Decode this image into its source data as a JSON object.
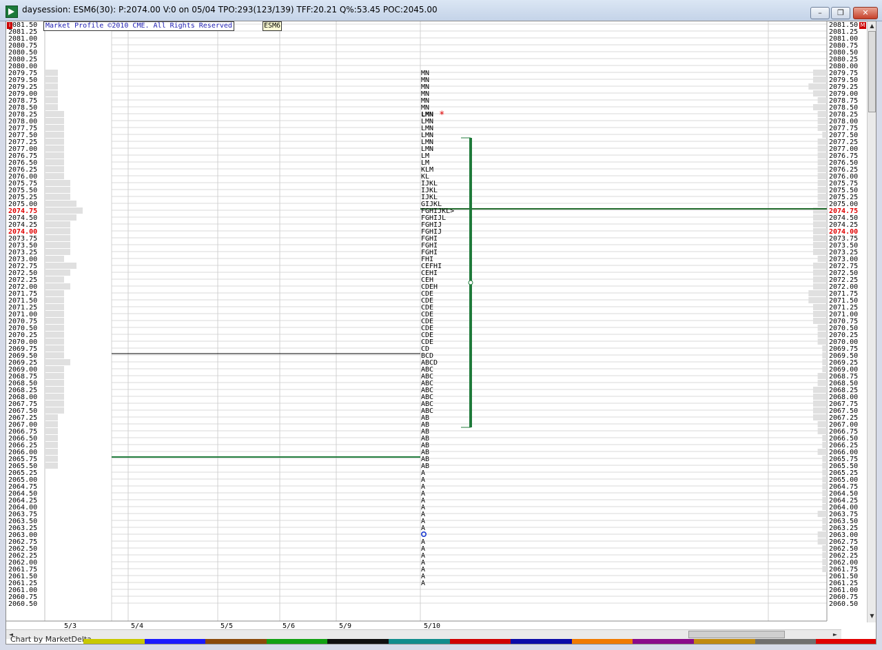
{
  "window": {
    "title": "daysession: ESM6(30): P:2074.00 V:0 on 05/04 TPO:293(123/139) TFF:20.21 Q%:53.45 POC:2045.00",
    "minimize_label": "–",
    "maximize_label": "❐",
    "close_label": "✕"
  },
  "header": {
    "copyright": "Market Profile ©2010 CME. All Rights Reserved",
    "symbol": "ESM6",
    "left_marker": "i",
    "right_marker": "M"
  },
  "credit": "Chart by MarketDelta",
  "scroll": {
    "up": "▲",
    "down": "▼",
    "left": "◄",
    "right": "►"
  },
  "colors": {
    "grid": "#d8d8d8",
    "value_area_line": "#1f7a3a",
    "poc_line": "#1f6a2a",
    "price_red": "#e00000",
    "volume_bar": "#e0e0e0",
    "tpo_text": "#000000",
    "close_marker": "#e00000",
    "open_marker": "#1a3ad0"
  },
  "color_strip": [
    "#c8c800",
    "#1a1aff",
    "#8b4a0a",
    "#12a012",
    "#101010",
    "#108c8c",
    "#d00000",
    "#0a0aa8",
    "#f07a00",
    "#8a0a8a",
    "#c08a10",
    "#707070",
    "#e00000"
  ],
  "chart_data": {
    "type": "table",
    "price_max": 2081.5,
    "price_min": 2060.5,
    "tick_size": 0.25,
    "highlighted_prices": [
      "2074.75",
      "2074.00"
    ],
    "sessions": [
      "5/3",
      "5/4",
      "5/5",
      "5/6",
      "5/9",
      "5/10"
    ],
    "reference_lines": [
      {
        "name": "value-area-high-ref",
        "price": 2069.5
      },
      {
        "name": "value-area-low-ref",
        "price": 2065.75
      },
      {
        "name": "poc-line",
        "price": 2074.75
      }
    ],
    "value_area": {
      "high": 2077.25,
      "low": 2067.0
    },
    "poc_label": "FGHIJKL>",
    "close_marker": "*",
    "open_marker": "o",
    "tpo_rows": [
      {
        "price": 2079.75,
        "letters": "MN"
      },
      {
        "price": 2079.5,
        "letters": "MN"
      },
      {
        "price": 2079.25,
        "letters": "MN"
      },
      {
        "price": 2079.0,
        "letters": "MN"
      },
      {
        "price": 2078.75,
        "letters": "MN"
      },
      {
        "price": 2078.5,
        "letters": "MN"
      },
      {
        "price": 2078.25,
        "letters": "LMN"
      },
      {
        "price": 2078.0,
        "letters": "LMN"
      },
      {
        "price": 2077.75,
        "letters": "LMN"
      },
      {
        "price": 2077.5,
        "letters": "LMN"
      },
      {
        "price": 2077.25,
        "letters": "LMN"
      },
      {
        "price": 2077.0,
        "letters": "LMN"
      },
      {
        "price": 2076.75,
        "letters": "LM"
      },
      {
        "price": 2076.5,
        "letters": "LM"
      },
      {
        "price": 2076.25,
        "letters": "KLM"
      },
      {
        "price": 2076.0,
        "letters": "KL"
      },
      {
        "price": 2075.75,
        "letters": "IJKL"
      },
      {
        "price": 2075.5,
        "letters": "IJKL"
      },
      {
        "price": 2075.25,
        "letters": "IJKL"
      },
      {
        "price": 2075.0,
        "letters": "GIJKL"
      },
      {
        "price": 2074.75,
        "letters": "FGHIJKL>"
      },
      {
        "price": 2074.5,
        "letters": "FGHIJL"
      },
      {
        "price": 2074.25,
        "letters": "FGHIJ"
      },
      {
        "price": 2074.0,
        "letters": "FGHIJ"
      },
      {
        "price": 2073.75,
        "letters": "FGHI"
      },
      {
        "price": 2073.5,
        "letters": "FGHI"
      },
      {
        "price": 2073.25,
        "letters": "FGHI"
      },
      {
        "price": 2073.0,
        "letters": "FHI"
      },
      {
        "price": 2072.75,
        "letters": "CEFHI"
      },
      {
        "price": 2072.5,
        "letters": "CEHI"
      },
      {
        "price": 2072.25,
        "letters": "CEH"
      },
      {
        "price": 2072.0,
        "letters": "CDEH"
      },
      {
        "price": 2071.75,
        "letters": "CDE"
      },
      {
        "price": 2071.5,
        "letters": "CDE"
      },
      {
        "price": 2071.25,
        "letters": "CDE"
      },
      {
        "price": 2071.0,
        "letters": "CDE"
      },
      {
        "price": 2070.75,
        "letters": "CDE"
      },
      {
        "price": 2070.5,
        "letters": "CDE"
      },
      {
        "price": 2070.25,
        "letters": "CDE"
      },
      {
        "price": 2070.0,
        "letters": "CDE"
      },
      {
        "price": 2069.75,
        "letters": "CD"
      },
      {
        "price": 2069.5,
        "letters": "BCD"
      },
      {
        "price": 2069.25,
        "letters": "ABCD"
      },
      {
        "price": 2069.0,
        "letters": "ABC"
      },
      {
        "price": 2068.75,
        "letters": "ABC"
      },
      {
        "price": 2068.5,
        "letters": "ABC"
      },
      {
        "price": 2068.25,
        "letters": "ABC"
      },
      {
        "price": 2068.0,
        "letters": "ABC"
      },
      {
        "price": 2067.75,
        "letters": "ABC"
      },
      {
        "price": 2067.5,
        "letters": "ABC"
      },
      {
        "price": 2067.25,
        "letters": "AB"
      },
      {
        "price": 2067.0,
        "letters": "AB"
      },
      {
        "price": 2066.75,
        "letters": "AB"
      },
      {
        "price": 2066.5,
        "letters": "AB"
      },
      {
        "price": 2066.25,
        "letters": "AB"
      },
      {
        "price": 2066.0,
        "letters": "AB"
      },
      {
        "price": 2065.75,
        "letters": "AB"
      },
      {
        "price": 2065.5,
        "letters": "AB"
      },
      {
        "price": 2065.25,
        "letters": "A"
      },
      {
        "price": 2065.0,
        "letters": "A"
      },
      {
        "price": 2064.75,
        "letters": "A"
      },
      {
        "price": 2064.5,
        "letters": "A"
      },
      {
        "price": 2064.25,
        "letters": "A"
      },
      {
        "price": 2064.0,
        "letters": "A"
      },
      {
        "price": 2063.75,
        "letters": "A"
      },
      {
        "price": 2063.5,
        "letters": "A"
      },
      {
        "price": 2063.25,
        "letters": "A"
      },
      {
        "price": 2063.0,
        "letters": "o"
      },
      {
        "price": 2062.75,
        "letters": "A"
      },
      {
        "price": 2062.5,
        "letters": "A"
      },
      {
        "price": 2062.25,
        "letters": "A"
      },
      {
        "price": 2062.0,
        "letters": "A"
      },
      {
        "price": 2061.75,
        "letters": "A"
      },
      {
        "price": 2061.5,
        "letters": "A"
      },
      {
        "price": 2061.25,
        "letters": "A"
      }
    ],
    "left_volume_profile": [
      {
        "price": 2079.75,
        "volume": 2
      },
      {
        "price": 2079.5,
        "volume": 2
      },
      {
        "price": 2079.25,
        "volume": 2
      },
      {
        "price": 2079.0,
        "volume": 2
      },
      {
        "price": 2078.75,
        "volume": 2
      },
      {
        "price": 2078.5,
        "volume": 2
      },
      {
        "price": 2078.25,
        "volume": 3
      },
      {
        "price": 2078.0,
        "volume": 3
      },
      {
        "price": 2077.75,
        "volume": 3
      },
      {
        "price": 2077.5,
        "volume": 3
      },
      {
        "price": 2077.25,
        "volume": 3
      },
      {
        "price": 2077.0,
        "volume": 3
      },
      {
        "price": 2076.75,
        "volume": 3
      },
      {
        "price": 2076.5,
        "volume": 3
      },
      {
        "price": 2076.25,
        "volume": 3
      },
      {
        "price": 2076.0,
        "volume": 3
      },
      {
        "price": 2075.75,
        "volume": 4
      },
      {
        "price": 2075.5,
        "volume": 4
      },
      {
        "price": 2075.25,
        "volume": 4
      },
      {
        "price": 2075.0,
        "volume": 5
      },
      {
        "price": 2074.75,
        "volume": 6
      },
      {
        "price": 2074.5,
        "volume": 5
      },
      {
        "price": 2074.25,
        "volume": 4
      },
      {
        "price": 2074.0,
        "volume": 4
      },
      {
        "price": 2073.75,
        "volume": 4
      },
      {
        "price": 2073.5,
        "volume": 4
      },
      {
        "price": 2073.25,
        "volume": 4
      },
      {
        "price": 2073.0,
        "volume": 3
      },
      {
        "price": 2072.75,
        "volume": 5
      },
      {
        "price": 2072.5,
        "volume": 4
      },
      {
        "price": 2072.25,
        "volume": 3
      },
      {
        "price": 2072.0,
        "volume": 4
      },
      {
        "price": 2071.75,
        "volume": 3
      },
      {
        "price": 2071.5,
        "volume": 3
      },
      {
        "price": 2071.25,
        "volume": 3
      },
      {
        "price": 2071.0,
        "volume": 3
      },
      {
        "price": 2070.75,
        "volume": 3
      },
      {
        "price": 2070.5,
        "volume": 3
      },
      {
        "price": 2070.25,
        "volume": 3
      },
      {
        "price": 2070.0,
        "volume": 3
      },
      {
        "price": 2069.75,
        "volume": 3
      },
      {
        "price": 2069.5,
        "volume": 3
      },
      {
        "price": 2069.25,
        "volume": 4
      },
      {
        "price": 2069.0,
        "volume": 3
      },
      {
        "price": 2068.75,
        "volume": 3
      },
      {
        "price": 2068.5,
        "volume": 3
      },
      {
        "price": 2068.25,
        "volume": 3
      },
      {
        "price": 2068.0,
        "volume": 3
      },
      {
        "price": 2067.75,
        "volume": 3
      },
      {
        "price": 2067.5,
        "volume": 3
      },
      {
        "price": 2067.25,
        "volume": 2
      },
      {
        "price": 2067.0,
        "volume": 2
      },
      {
        "price": 2066.75,
        "volume": 2
      },
      {
        "price": 2066.5,
        "volume": 2
      },
      {
        "price": 2066.25,
        "volume": 2
      },
      {
        "price": 2066.0,
        "volume": 2
      },
      {
        "price": 2065.75,
        "volume": 2
      },
      {
        "price": 2065.5,
        "volume": 2
      }
    ],
    "right_volume_profile": [
      {
        "price": 2079.75,
        "volume": 3
      },
      {
        "price": 2079.5,
        "volume": 3
      },
      {
        "price": 2079.25,
        "volume": 4
      },
      {
        "price": 2079.0,
        "volume": 3
      },
      {
        "price": 2078.75,
        "volume": 2
      },
      {
        "price": 2078.5,
        "volume": 3
      },
      {
        "price": 2078.25,
        "volume": 2
      },
      {
        "price": 2078.0,
        "volume": 2
      },
      {
        "price": 2077.75,
        "volume": 2
      },
      {
        "price": 2077.5,
        "volume": 1
      },
      {
        "price": 2077.25,
        "volume": 2
      },
      {
        "price": 2077.0,
        "volume": 2
      },
      {
        "price": 2076.75,
        "volume": 2
      },
      {
        "price": 2076.5,
        "volume": 2
      },
      {
        "price": 2076.25,
        "volume": 2
      },
      {
        "price": 2076.0,
        "volume": 2
      },
      {
        "price": 2075.75,
        "volume": 2
      },
      {
        "price": 2075.5,
        "volume": 2
      },
      {
        "price": 2075.25,
        "volume": 2
      },
      {
        "price": 2075.0,
        "volume": 2
      },
      {
        "price": 2074.75,
        "volume": 3
      },
      {
        "price": 2074.5,
        "volume": 3
      },
      {
        "price": 2074.25,
        "volume": 3
      },
      {
        "price": 2074.0,
        "volume": 3
      },
      {
        "price": 2073.75,
        "volume": 3
      },
      {
        "price": 2073.5,
        "volume": 3
      },
      {
        "price": 2073.25,
        "volume": 3
      },
      {
        "price": 2073.0,
        "volume": 2
      },
      {
        "price": 2072.75,
        "volume": 3
      },
      {
        "price": 2072.5,
        "volume": 3
      },
      {
        "price": 2072.25,
        "volume": 3
      },
      {
        "price": 2072.0,
        "volume": 3
      },
      {
        "price": 2071.75,
        "volume": 4
      },
      {
        "price": 2071.5,
        "volume": 4
      },
      {
        "price": 2071.25,
        "volume": 3
      },
      {
        "price": 2071.0,
        "volume": 3
      },
      {
        "price": 2070.75,
        "volume": 3
      },
      {
        "price": 2070.5,
        "volume": 2
      },
      {
        "price": 2070.25,
        "volume": 2
      },
      {
        "price": 2070.0,
        "volume": 2
      },
      {
        "price": 2069.75,
        "volume": 1
      },
      {
        "price": 2069.5,
        "volume": 1
      },
      {
        "price": 2069.25,
        "volume": 1
      },
      {
        "price": 2069.0,
        "volume": 1
      },
      {
        "price": 2068.75,
        "volume": 2
      },
      {
        "price": 2068.5,
        "volume": 2
      },
      {
        "price": 2068.25,
        "volume": 3
      },
      {
        "price": 2068.0,
        "volume": 3
      },
      {
        "price": 2067.75,
        "volume": 3
      },
      {
        "price": 2067.5,
        "volume": 3
      },
      {
        "price": 2067.25,
        "volume": 3
      },
      {
        "price": 2067.0,
        "volume": 2
      },
      {
        "price": 2066.75,
        "volume": 2
      },
      {
        "price": 2066.5,
        "volume": 1
      },
      {
        "price": 2066.25,
        "volume": 1
      },
      {
        "price": 2066.0,
        "volume": 2
      },
      {
        "price": 2065.75,
        "volume": 1
      },
      {
        "price": 2065.5,
        "volume": 1
      },
      {
        "price": 2065.25,
        "volume": 1
      },
      {
        "price": 2065.0,
        "volume": 1
      },
      {
        "price": 2064.75,
        "volume": 1
      },
      {
        "price": 2064.5,
        "volume": 1
      },
      {
        "price": 2064.25,
        "volume": 1
      },
      {
        "price": 2064.0,
        "volume": 1
      },
      {
        "price": 2063.75,
        "volume": 2
      },
      {
        "price": 2063.5,
        "volume": 1
      },
      {
        "price": 2063.25,
        "volume": 1
      },
      {
        "price": 2063.0,
        "volume": 2
      },
      {
        "price": 2062.75,
        "volume": 2
      },
      {
        "price": 2062.5,
        "volume": 1
      },
      {
        "price": 2062.25,
        "volume": 1
      },
      {
        "price": 2062.0,
        "volume": 1
      },
      {
        "price": 2061.75,
        "volume": 1
      }
    ]
  }
}
